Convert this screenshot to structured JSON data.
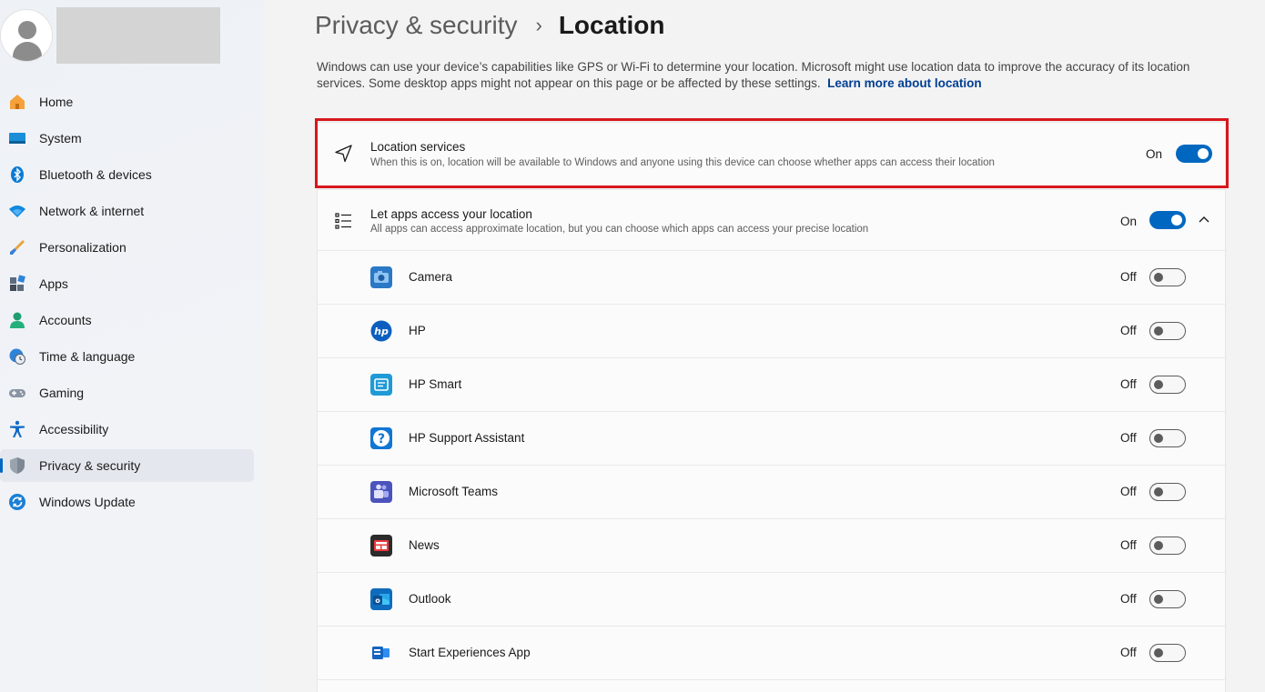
{
  "sidebar": {
    "items": [
      {
        "label": "Home",
        "icon": "home-icon"
      },
      {
        "label": "System",
        "icon": "system-icon"
      },
      {
        "label": "Bluetooth & devices",
        "icon": "bluetooth-icon"
      },
      {
        "label": "Network & internet",
        "icon": "wifi-icon"
      },
      {
        "label": "Personalization",
        "icon": "brush-icon"
      },
      {
        "label": "Apps",
        "icon": "apps-icon"
      },
      {
        "label": "Accounts",
        "icon": "account-icon"
      },
      {
        "label": "Time & language",
        "icon": "clock-globe-icon"
      },
      {
        "label": "Gaming",
        "icon": "gamepad-icon"
      },
      {
        "label": "Accessibility",
        "icon": "accessibility-icon"
      },
      {
        "label": "Privacy & security",
        "icon": "shield-icon",
        "active": true
      },
      {
        "label": "Windows Update",
        "icon": "update-icon"
      }
    ]
  },
  "header": {
    "parent": "Privacy & security",
    "separator": "›",
    "current": "Location"
  },
  "description": {
    "text": "Windows can use your device’s capabilities like GPS or Wi-Fi to determine your location. Microsoft might use location data to improve the accuracy of its location services. Some desktop apps might not appear on this page or be affected by these settings.",
    "link": "Learn more about location"
  },
  "location_services": {
    "title": "Location services",
    "subtitle": "When this is on, location will be available to Windows and anyone using this device can choose whether apps can access their location",
    "state": "On",
    "enabled": true
  },
  "app_access": {
    "title": "Let apps access your location",
    "subtitle": "All apps can access approximate location, but you can choose which apps can access your precise location",
    "state": "On",
    "enabled": true,
    "apps": [
      {
        "name": "Camera",
        "state": "Off",
        "icon": "camera-app-icon"
      },
      {
        "name": "HP",
        "state": "Off",
        "icon": "hp-app-icon"
      },
      {
        "name": "HP Smart",
        "state": "Off",
        "icon": "hp-smart-app-icon"
      },
      {
        "name": "HP Support Assistant",
        "state": "Off",
        "icon": "hp-support-app-icon"
      },
      {
        "name": "Microsoft Teams",
        "state": "Off",
        "icon": "teams-app-icon"
      },
      {
        "name": "News",
        "state": "Off",
        "icon": "news-app-icon"
      },
      {
        "name": "Outlook",
        "state": "Off",
        "icon": "outlook-app-icon"
      },
      {
        "name": "Start Experiences App",
        "state": "Off",
        "icon": "start-experiences-app-icon"
      }
    ]
  },
  "colors": {
    "accent": "#0067c0",
    "highlight_border": "#d7161d",
    "link": "#003e92"
  }
}
